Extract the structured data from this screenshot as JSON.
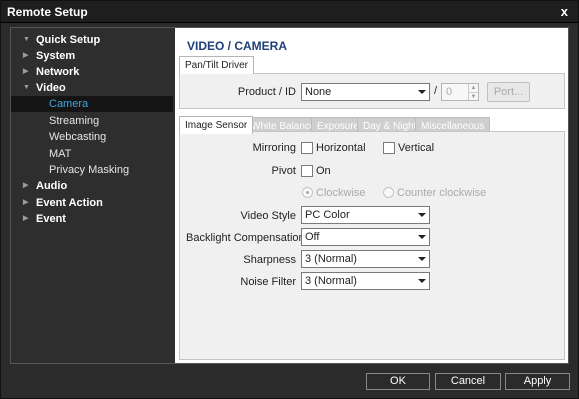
{
  "window": {
    "title": "Remote Setup",
    "close_glyph": "x"
  },
  "sidebar": {
    "items": [
      {
        "label": "Quick Setup"
      },
      {
        "label": "System"
      },
      {
        "label": "Network"
      },
      {
        "label": "Video"
      },
      {
        "label": "Camera"
      },
      {
        "label": "Streaming"
      },
      {
        "label": "Webcasting"
      },
      {
        "label": "MAT"
      },
      {
        "label": "Privacy Masking"
      },
      {
        "label": "Audio"
      },
      {
        "label": "Event Action"
      },
      {
        "label": "Event"
      }
    ],
    "active_item": "Camera"
  },
  "page_title": "VIDEO / CAMERA",
  "pan_tilt": {
    "tab_label": "Pan/Tilt Driver",
    "product_label": "Product / ID",
    "product_value": "None",
    "separator": "/",
    "id_value": "0",
    "port_button": "Port..."
  },
  "image_tabs": [
    "Image Sensor",
    "White Balance",
    "Exposure",
    "Day & Night",
    "Miscellaneous"
  ],
  "image_sensor": {
    "mirroring_label": "Mirroring",
    "horizontal_label": "Horizontal",
    "horizontal_checked": false,
    "vertical_label": "Vertical",
    "vertical_checked": false,
    "pivot_label": "Pivot",
    "on_label": "On",
    "pivot_checked": false,
    "clockwise_label": "Clockwise",
    "counter_clockwise_label": "Counter clockwise",
    "rotation_selected": "Clockwise",
    "video_style_label": "Video Style",
    "video_style_value": "PC Color",
    "backlight_label": "Backlight Compensation",
    "backlight_value": "Off",
    "sharpness_label": "Sharpness",
    "sharpness_value": "3 (Normal)",
    "noise_filter_label": "Noise Filter",
    "noise_filter_value": "3 (Normal)"
  },
  "footer": {
    "ok_label": "OK",
    "cancel_label": "Cancel",
    "apply_label": "Apply"
  },
  "colors": {
    "window_bg": "#2b2b2b",
    "active_nav": "#3fa7e0",
    "title_blue": "#1f3f7a",
    "panel_bg": "#f0f0f0"
  },
  "icons": [
    "close-icon",
    "triangle-right-icon",
    "triangle-down-icon",
    "dropdown-caret-icon",
    "spinner-arrows-icon"
  ]
}
